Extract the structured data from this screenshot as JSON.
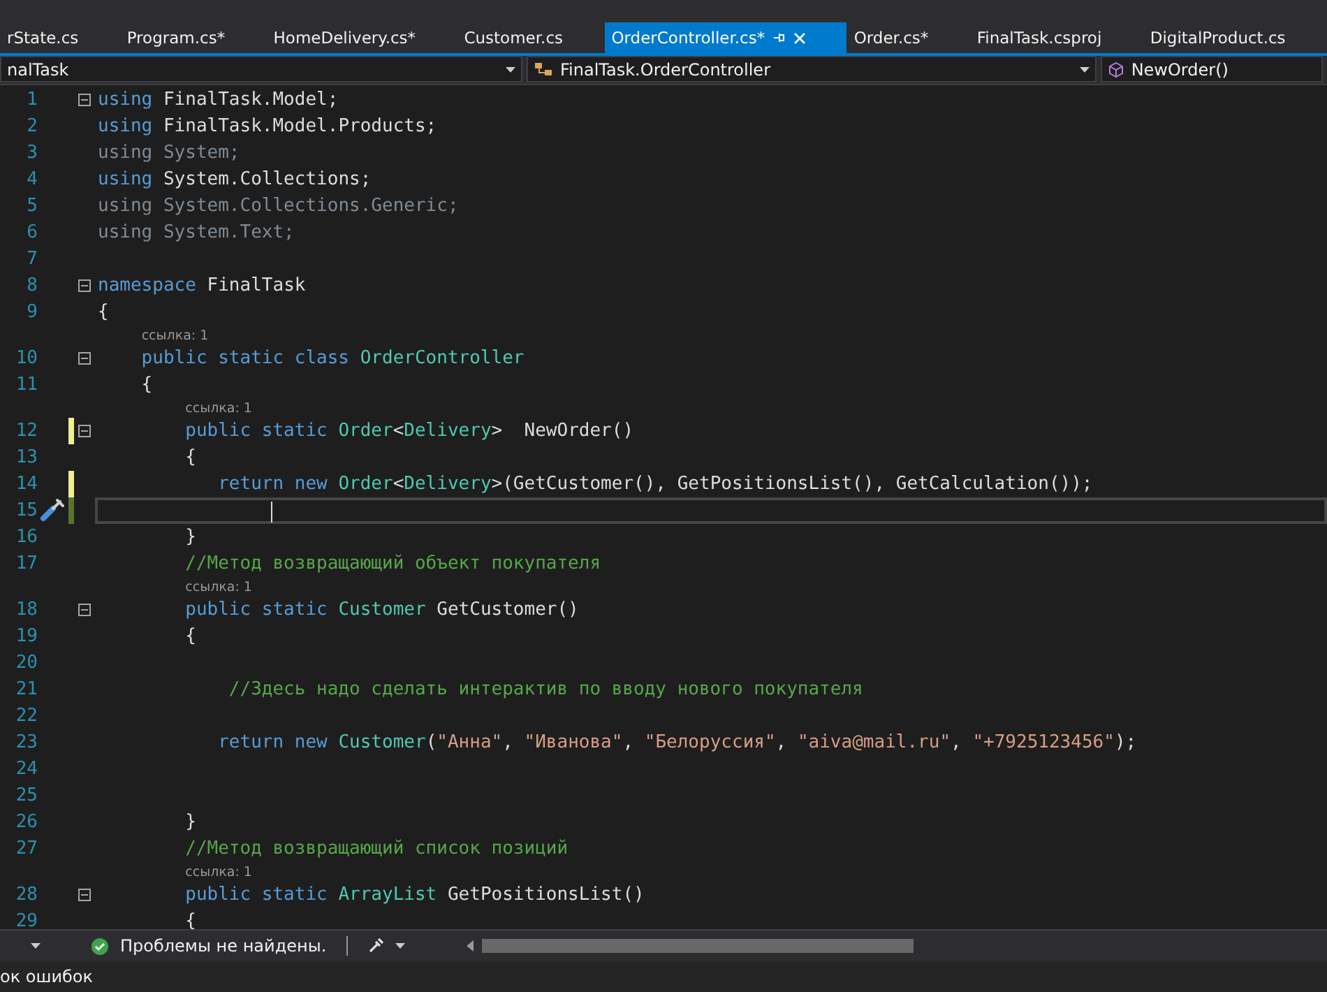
{
  "tabs": [
    {
      "label": "rState.cs",
      "selected": false
    },
    {
      "label": "Program.cs*",
      "selected": false
    },
    {
      "label": "HomeDelivery.cs*",
      "selected": false
    },
    {
      "label": "Customer.cs",
      "selected": false
    },
    {
      "label": "OrderController.cs*",
      "selected": true
    },
    {
      "label": "Order.cs*",
      "selected": false
    },
    {
      "label": "FinalTask.csproj",
      "selected": false
    },
    {
      "label": "DigitalProduct.cs",
      "selected": false
    }
  ],
  "navigation": {
    "project": "nalTask",
    "type": "FinalTask.OrderController",
    "member": "NewOrder()"
  },
  "editor": {
    "lines": [
      {
        "kind": "code",
        "number": "1",
        "fold": true,
        "edited": false,
        "saved": false,
        "current": false,
        "tokens": [
          {
            "t": "using ",
            "kind": "kw"
          },
          {
            "t": "FinalTask.Model;",
            "kind": "plain"
          }
        ]
      },
      {
        "kind": "code",
        "number": "2",
        "fold": false,
        "edited": false,
        "saved": false,
        "current": false,
        "tokens": [
          {
            "t": "using ",
            "kind": "kw"
          },
          {
            "t": "FinalTask.Model.Products;",
            "kind": "plain"
          }
        ]
      },
      {
        "kind": "code",
        "number": "3",
        "fold": false,
        "edited": false,
        "saved": false,
        "current": false,
        "tokens": [
          {
            "t": "using ",
            "kind": "dim"
          },
          {
            "t": "System;",
            "kind": "dim"
          }
        ]
      },
      {
        "kind": "code",
        "number": "4",
        "fold": false,
        "edited": false,
        "saved": false,
        "current": false,
        "tokens": [
          {
            "t": "using ",
            "kind": "kw"
          },
          {
            "t": "System.Collections;",
            "kind": "plain"
          }
        ]
      },
      {
        "kind": "code",
        "number": "5",
        "fold": false,
        "edited": false,
        "saved": false,
        "current": false,
        "tokens": [
          {
            "t": "using ",
            "kind": "dim"
          },
          {
            "t": "System.Collections.Generic;",
            "kind": "dim"
          }
        ]
      },
      {
        "kind": "code",
        "number": "6",
        "fold": false,
        "edited": false,
        "saved": false,
        "current": false,
        "tokens": [
          {
            "t": "using ",
            "kind": "dim"
          },
          {
            "t": "System.Text;",
            "kind": "dim"
          }
        ]
      },
      {
        "kind": "code",
        "number": "7",
        "fold": false,
        "edited": false,
        "saved": false,
        "current": false
      },
      {
        "kind": "code",
        "number": "8",
        "fold": true,
        "edited": false,
        "saved": false,
        "current": false,
        "tokens": [
          {
            "t": "namespace ",
            "kind": "kw"
          },
          {
            "t": "FinalTask",
            "kind": "plain"
          }
        ]
      },
      {
        "kind": "code",
        "number": "9",
        "fold": false,
        "edited": false,
        "saved": false,
        "current": false,
        "tokens": [
          {
            "t": "{",
            "kind": "plain"
          }
        ]
      },
      {
        "kind": "hint",
        "text": "ссылка: 1"
      },
      {
        "kind": "code",
        "number": "10",
        "fold": true,
        "edited": false,
        "saved": false,
        "current": false,
        "tokens": [
          {
            "t": "    public static class ",
            "kind": "kw"
          },
          {
            "t": "OrderController",
            "kind": "type"
          }
        ]
      },
      {
        "kind": "code",
        "number": "11",
        "fold": false,
        "edited": false,
        "saved": false,
        "current": false,
        "tokens": [
          {
            "t": "    {",
            "kind": "plain"
          }
        ]
      },
      {
        "kind": "hint",
        "text": "ссылка: 1"
      },
      {
        "kind": "code",
        "number": "12",
        "fold": true,
        "edited": true,
        "saved": false,
        "current": false,
        "tokens": [
          {
            "t": "        public static ",
            "kind": "kw"
          },
          {
            "t": "Order",
            "kind": "type"
          },
          {
            "t": "<",
            "kind": "plain"
          },
          {
            "t": "Delivery",
            "kind": "type"
          },
          {
            "t": ">  NewOrder()",
            "kind": "plain"
          }
        ]
      },
      {
        "kind": "code",
        "number": "13",
        "fold": false,
        "edited": false,
        "saved": false,
        "current": false,
        "tokens": [
          {
            "t": "        {",
            "kind": "plain"
          }
        ]
      },
      {
        "kind": "code",
        "number": "14",
        "fold": false,
        "edited": true,
        "saved": false,
        "current": false,
        "tokens": [
          {
            "t": "           return new ",
            "kind": "kw"
          },
          {
            "t": "Order",
            "kind": "type"
          },
          {
            "t": "<",
            "kind": "plain"
          },
          {
            "t": "Delivery",
            "kind": "type"
          },
          {
            "t": ">(GetCustomer(), GetPositionsList(), GetCalculation());",
            "kind": "plain"
          }
        ]
      },
      {
        "kind": "code",
        "number": "15",
        "fold": false,
        "edited": true,
        "saved": true,
        "current": true
      },
      {
        "kind": "code",
        "number": "16",
        "fold": false,
        "edited": false,
        "saved": false,
        "current": false,
        "tokens": [
          {
            "t": "        }",
            "kind": "plain"
          }
        ]
      },
      {
        "kind": "code",
        "number": "17",
        "fold": false,
        "edited": false,
        "saved": false,
        "current": false,
        "tokens": [
          {
            "t": "        //Метод возвращающий объект покупателя",
            "kind": "com"
          }
        ]
      },
      {
        "kind": "hint",
        "text": "ссылка: 1"
      },
      {
        "kind": "code",
        "number": "18",
        "fold": true,
        "edited": false,
        "saved": false,
        "current": false,
        "tokens": [
          {
            "t": "        public static ",
            "kind": "kw"
          },
          {
            "t": "Customer",
            "kind": "type"
          },
          {
            "t": " GetCustomer()",
            "kind": "plain"
          }
        ]
      },
      {
        "kind": "code",
        "number": "19",
        "fold": false,
        "edited": false,
        "saved": false,
        "current": false,
        "tokens": [
          {
            "t": "        {",
            "kind": "plain"
          }
        ]
      },
      {
        "kind": "code",
        "number": "20",
        "fold": false,
        "edited": false,
        "saved": false,
        "current": false
      },
      {
        "kind": "code",
        "number": "21",
        "fold": false,
        "edited": false,
        "saved": false,
        "current": false,
        "tokens": [
          {
            "t": "            //Здесь надо сделать интерактив по вводу нового покупателя",
            "kind": "com"
          }
        ]
      },
      {
        "kind": "code",
        "number": "22",
        "fold": false,
        "edited": false,
        "saved": false,
        "current": false
      },
      {
        "kind": "code",
        "number": "23",
        "fold": false,
        "edited": false,
        "saved": false,
        "current": false,
        "tokens": [
          {
            "t": "           return new ",
            "kind": "kw"
          },
          {
            "t": "Customer",
            "kind": "type"
          },
          {
            "t": "(",
            "kind": "plain"
          },
          {
            "t": "\"Анна\"",
            "kind": "str"
          },
          {
            "t": ", ",
            "kind": "plain"
          },
          {
            "t": "\"Иванова\"",
            "kind": "str"
          },
          {
            "t": ", ",
            "kind": "plain"
          },
          {
            "t": "\"Белоруссия\"",
            "kind": "str"
          },
          {
            "t": ", ",
            "kind": "plain"
          },
          {
            "t": "\"aiva@mail.ru\"",
            "kind": "str"
          },
          {
            "t": ", ",
            "kind": "plain"
          },
          {
            "t": "\"+7925123456\"",
            "kind": "str"
          },
          {
            "t": ");",
            "kind": "plain"
          }
        ]
      },
      {
        "kind": "code",
        "number": "24",
        "fold": false,
        "edited": false,
        "saved": false,
        "current": false
      },
      {
        "kind": "code",
        "number": "25",
        "fold": false,
        "edited": false,
        "saved": false,
        "current": false
      },
      {
        "kind": "code",
        "number": "26",
        "fold": false,
        "edited": false,
        "saved": false,
        "current": false,
        "tokens": [
          {
            "t": "        }",
            "kind": "plain"
          }
        ]
      },
      {
        "kind": "code",
        "number": "27",
        "fold": false,
        "edited": false,
        "saved": false,
        "current": false,
        "tokens": [
          {
            "t": "        //Метод возвращающий список позиций",
            "kind": "com"
          }
        ]
      },
      {
        "kind": "hint",
        "text": "ссылка: 1"
      },
      {
        "kind": "code",
        "number": "28",
        "fold": true,
        "edited": false,
        "saved": false,
        "current": false,
        "tokens": [
          {
            "t": "        public static ",
            "kind": "kw"
          },
          {
            "t": "ArrayList",
            "kind": "type"
          },
          {
            "t": " GetPositionsList()",
            "kind": "plain"
          }
        ]
      },
      {
        "kind": "code",
        "number": "29",
        "fold": false,
        "edited": false,
        "saved": false,
        "current": false,
        "tokens": [
          {
            "t": "        {",
            "kind": "plain"
          }
        ]
      }
    ]
  },
  "status_bar": {
    "issues": "Проблемы не найдены."
  },
  "bottom_panel": {
    "tab": "ок ошибок"
  }
}
